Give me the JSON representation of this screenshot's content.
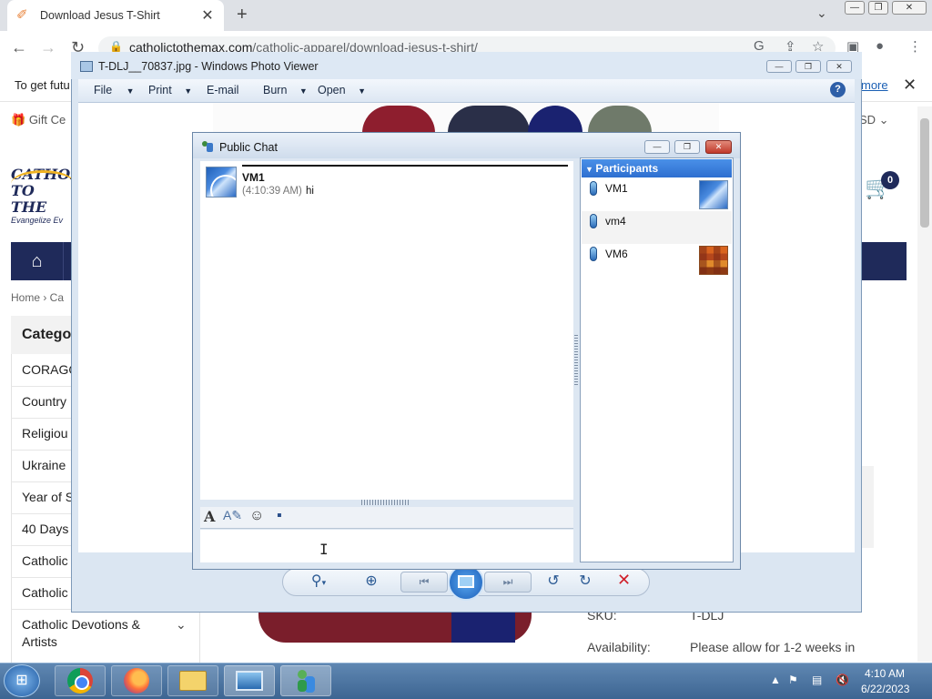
{
  "browser": {
    "tab_title": "Download Jesus T-Shirt",
    "url_domain": "catholictothemax.com",
    "url_path": "/catholic-apparel/download-jesus-t-shirt/",
    "infobar_text": "To get futu",
    "infobar_link": "more"
  },
  "webpage": {
    "gift_text": "Gift Ce",
    "currency": "SD",
    "logo_line1": "CATHOL",
    "logo_line2": "TO THE",
    "logo_line3": "Evangelize Ev",
    "cart_count": "0",
    "breadcrumb": "Home  ›  Ca",
    "categories_title": "Catego",
    "categories": [
      "CORAGO",
      "Country",
      "Religiou",
      "Ukraine",
      "Year of S",
      "40 Days",
      "Catholic",
      "Catholic",
      "Catholic Devotions & Artists"
    ],
    "sku_label": "SKU:",
    "sku_value": "T-DLJ",
    "availability_label": "Availability:",
    "availability_value": "Please allow for 1-2 weeks in"
  },
  "photo_viewer": {
    "title": "T-DLJ__70837.jpg - Windows Photo Viewer",
    "menus": [
      "File",
      "Print",
      "E-mail",
      "Burn",
      "Open"
    ],
    "help": "?"
  },
  "chat": {
    "title": "Public Chat",
    "messages": [
      {
        "sender": "VM1",
        "time": "(4:10:39 AM)",
        "text": "hi"
      }
    ],
    "participants_header": "Participants",
    "participants": [
      "VM1",
      "vm4",
      "VM6"
    ]
  },
  "taskbar": {
    "time": "4:10 AM",
    "date": "6/22/2023"
  },
  "colors": {
    "brand_navy": "#1f2a5a",
    "participants_header": "#2e6fd0",
    "delete_red": "#d0202a"
  }
}
